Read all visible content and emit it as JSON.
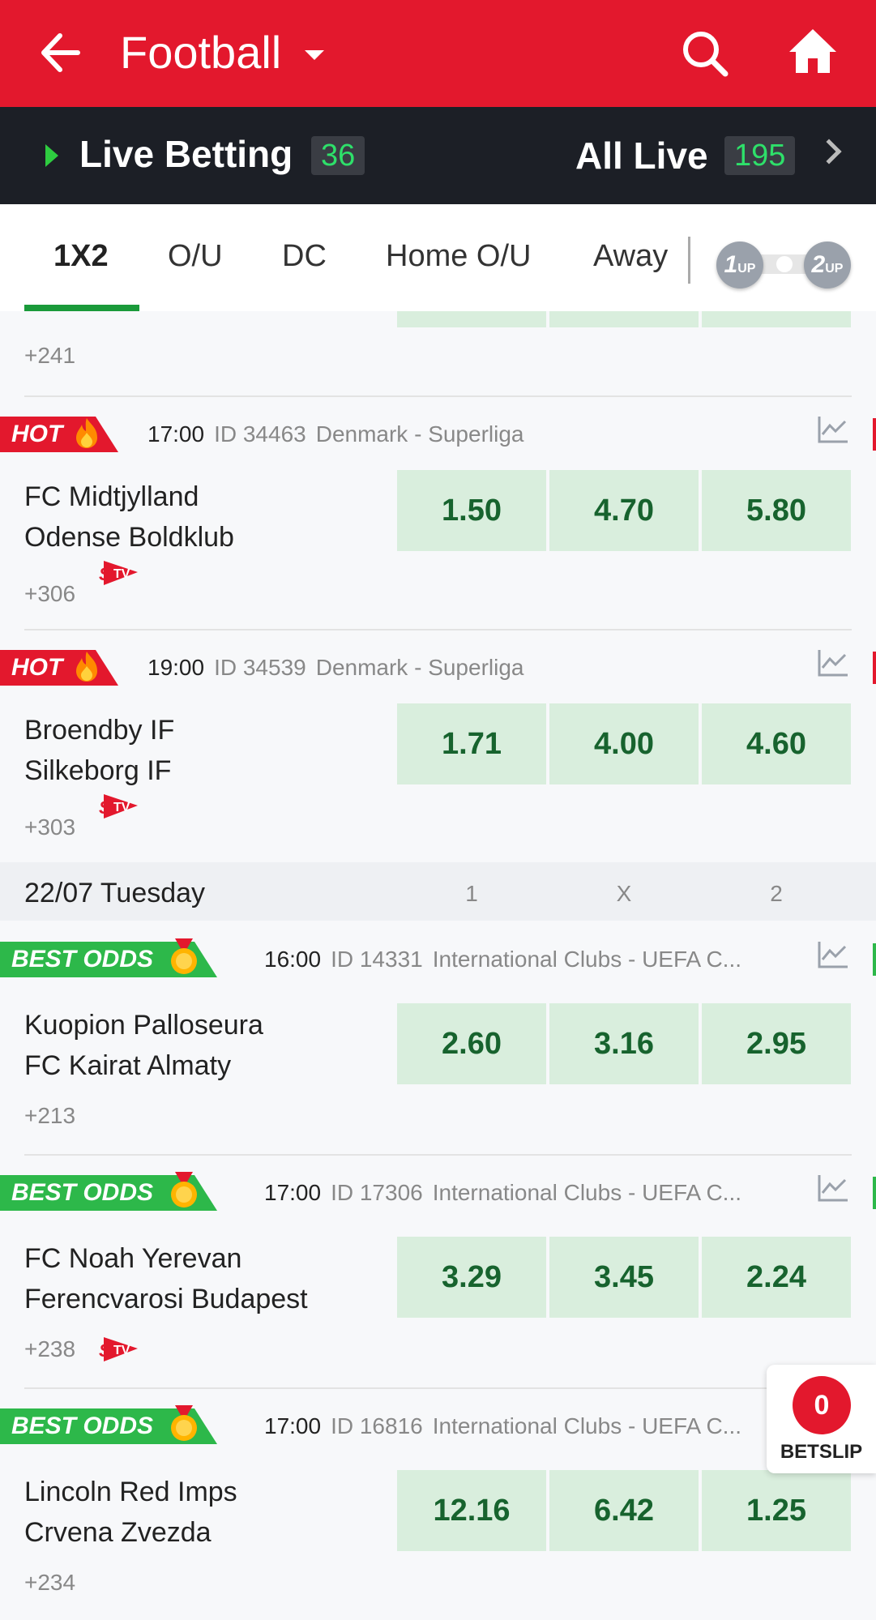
{
  "header": {
    "title": "Football"
  },
  "live_bar": {
    "live_label": "Live Betting",
    "live_count": "36",
    "all_label": "All Live",
    "all_count": "195"
  },
  "tabs": [
    "1X2",
    "O/U",
    "DC",
    "Home O/U",
    "Away"
  ],
  "toggle": {
    "left": "1",
    "left_sub": "UP",
    "right": "2",
    "right_sub": "UP"
  },
  "top_fragment": {
    "more": "+241"
  },
  "date_header": {
    "date": "22/07 Tuesday",
    "col1": "1",
    "colx": "X",
    "col2": "2"
  },
  "badges": {
    "hot": "HOT",
    "best": "BEST ODDS"
  },
  "matches": [
    {
      "badge": "hot",
      "time": "17:00",
      "id": "ID 34463",
      "league": "Denmark - Superliga",
      "home": "FC Midtjylland",
      "away": "Odense Boldklub",
      "odds": [
        "1.50",
        "4.70",
        "5.80"
      ],
      "more": "+306",
      "stv": true
    },
    {
      "badge": "hot",
      "time": "19:00",
      "id": "ID 34539",
      "league": "Denmark - Superliga",
      "home": "Broendby IF",
      "away": "Silkeborg IF",
      "odds": [
        "1.71",
        "4.00",
        "4.60"
      ],
      "more": "+303",
      "stv": true
    },
    {
      "badge": "best",
      "time": "16:00",
      "id": "ID 14331",
      "league": "International Clubs - UEFA C...",
      "home": "Kuopion Palloseura",
      "away": "FC Kairat Almaty",
      "odds": [
        "2.60",
        "3.16",
        "2.95"
      ],
      "more": "+213",
      "stv": false
    },
    {
      "badge": "best",
      "time": "17:00",
      "id": "ID 17306",
      "league": "International Clubs - UEFA C...",
      "home": "FC Noah Yerevan",
      "away": "Ferencvarosi Budapest",
      "odds": [
        "3.29",
        "3.45",
        "2.24"
      ],
      "more": "+238",
      "stv": true
    },
    {
      "badge": "best",
      "time": "17:00",
      "id": "ID 16816",
      "league": "International Clubs - UEFA C...",
      "home": "Lincoln Red Imps",
      "away": "Crvena Zvezda",
      "odds": [
        "12.16",
        "6.42",
        "1.25"
      ],
      "more": "+234",
      "stv": false
    }
  ],
  "betslip": {
    "count": "0",
    "label": "BETSLIP"
  },
  "colors": {
    "brand_red": "#e3182d",
    "dark_bar": "#1c1f26",
    "live_green": "#2ee06a",
    "odds_bg": "#d9eedd",
    "odds_text": "#17632e",
    "best_green": "#2db84a"
  },
  "icons": {
    "back": "arrow-left-icon",
    "search": "search-icon",
    "home": "home-icon",
    "stats": "stats-chart-icon",
    "stv": "stv-icon",
    "flame": "flame-icon",
    "medal": "medal-icon"
  }
}
